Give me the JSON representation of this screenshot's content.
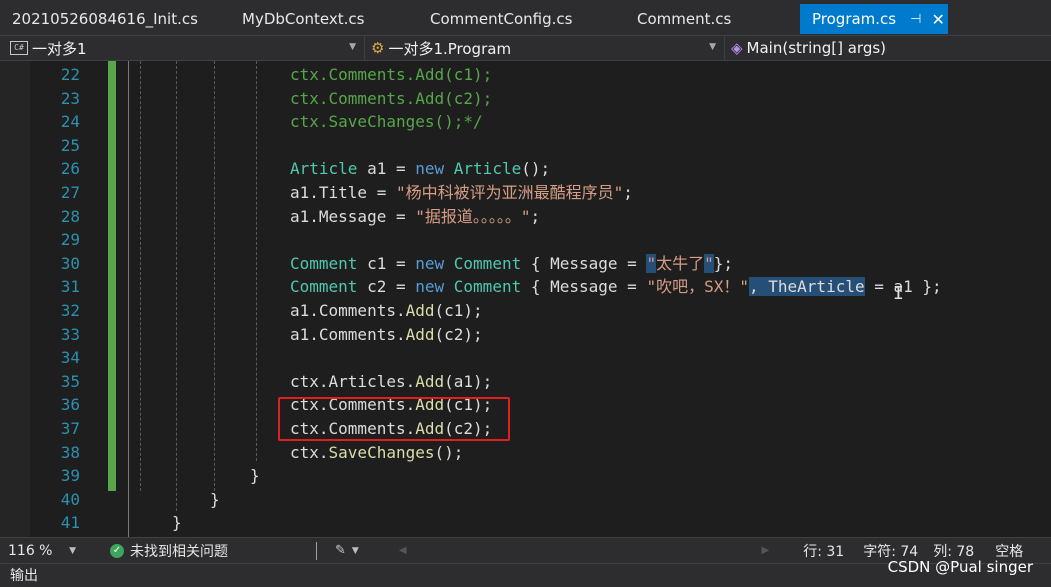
{
  "tabs": [
    {
      "label": "20210526084616_Init.cs"
    },
    {
      "label": "MyDbContext.cs"
    },
    {
      "label": "CommentConfig.cs"
    },
    {
      "label": "Comment.cs"
    },
    {
      "label": "Program.cs",
      "active": true,
      "pin": "⊣",
      "close": "✕"
    }
  ],
  "nav": {
    "project": "一对多1",
    "class": "一对多1.Program",
    "member": "Main(string[] args)"
  },
  "editor": {
    "line_numbers": [
      "22",
      "23",
      "24",
      "25",
      "26",
      "27",
      "28",
      "29",
      "30",
      "31",
      "32",
      "33",
      "34",
      "35",
      "36",
      "37",
      "38",
      "39",
      "40",
      "41"
    ],
    "lines": [
      {
        "n": "22",
        "tokens": [
          {
            "t": "ctx.Comments.Add(c1);",
            "c": "comment"
          }
        ]
      },
      {
        "n": "23",
        "tokens": [
          {
            "t": "ctx.Comments.Add(c2);",
            "c": "comment"
          }
        ]
      },
      {
        "n": "24",
        "tokens": [
          {
            "t": "ctx.SaveChanges();*/",
            "c": "comment"
          }
        ]
      },
      {
        "n": "25",
        "tokens": []
      },
      {
        "n": "26",
        "tokens": [
          {
            "t": "Article",
            "c": "type"
          },
          {
            "t": " a1 = ",
            "c": "id"
          },
          {
            "t": "new",
            "c": "kw"
          },
          {
            "t": " ",
            "c": "id"
          },
          {
            "t": "Article",
            "c": "type"
          },
          {
            "t": "();",
            "c": "id"
          }
        ]
      },
      {
        "n": "27",
        "tokens": [
          {
            "t": "a1.Title = ",
            "c": "id"
          },
          {
            "t": "\"杨中科被评为亚洲最酷程序员\"",
            "c": "str"
          },
          {
            "t": ";",
            "c": "id"
          }
        ]
      },
      {
        "n": "28",
        "tokens": [
          {
            "t": "a1.Message = ",
            "c": "id"
          },
          {
            "t": "\"据报道。。。。。\"",
            "c": "str"
          },
          {
            "t": ";",
            "c": "id"
          }
        ]
      },
      {
        "n": "29",
        "tokens": []
      },
      {
        "n": "30",
        "tokens": [
          {
            "t": "Comment",
            "c": "type"
          },
          {
            "t": " c1 = ",
            "c": "id"
          },
          {
            "t": "new",
            "c": "kw"
          },
          {
            "t": " ",
            "c": "id"
          },
          {
            "t": "Comment",
            "c": "type"
          },
          {
            "t": " { Message = ",
            "c": "id"
          },
          {
            "t": "\"",
            "c": "str hl"
          },
          {
            "t": "太牛了",
            "c": "str"
          },
          {
            "t": "\"",
            "c": "str hl"
          },
          {
            "t": "};",
            "c": "id"
          }
        ]
      },
      {
        "n": "31",
        "tokens": [
          {
            "t": "Comment",
            "c": "type"
          },
          {
            "t": " c2 = ",
            "c": "id"
          },
          {
            "t": "new",
            "c": "kw"
          },
          {
            "t": " ",
            "c": "id"
          },
          {
            "t": "Comment",
            "c": "type"
          },
          {
            "t": " { Message = ",
            "c": "id"
          },
          {
            "t": "\"吹吧，SX！\"",
            "c": "str"
          },
          {
            "t": ", TheArticle",
            "c": "id hl"
          },
          {
            "t": " = a1 };",
            "c": "id"
          }
        ]
      },
      {
        "n": "32",
        "tokens": [
          {
            "t": "a1.Comments.",
            "c": "id"
          },
          {
            "t": "Add",
            "c": "method"
          },
          {
            "t": "(c1);",
            "c": "id"
          }
        ]
      },
      {
        "n": "33",
        "tokens": [
          {
            "t": "a1.Comments.",
            "c": "id"
          },
          {
            "t": "Add",
            "c": "method"
          },
          {
            "t": "(c2);",
            "c": "id"
          }
        ]
      },
      {
        "n": "34",
        "tokens": []
      },
      {
        "n": "35",
        "tokens": [
          {
            "t": "ctx.Articles.",
            "c": "id"
          },
          {
            "t": "Add",
            "c": "method"
          },
          {
            "t": "(a1);",
            "c": "id"
          }
        ]
      },
      {
        "n": "36",
        "tokens": [
          {
            "t": "ctx.Comments.",
            "c": "id"
          },
          {
            "t": "Add",
            "c": "method"
          },
          {
            "t": "(c1);",
            "c": "id"
          }
        ]
      },
      {
        "n": "37",
        "tokens": [
          {
            "t": "ctx.Comments.",
            "c": "id"
          },
          {
            "t": "Add",
            "c": "method"
          },
          {
            "t": "(c2);",
            "c": "id"
          }
        ]
      },
      {
        "n": "38",
        "tokens": [
          {
            "t": "ctx.",
            "c": "id"
          },
          {
            "t": "SaveChanges",
            "c": "method"
          },
          {
            "t": "();",
            "c": "id"
          }
        ]
      },
      {
        "n": "39",
        "tokens": []
      },
      {
        "n": "40",
        "tokens": []
      },
      {
        "n": "41",
        "tokens": []
      }
    ],
    "braces": [
      {
        "line": "39",
        "text": "}"
      },
      {
        "line": "40",
        "text": "}"
      },
      {
        "line": "41",
        "text": "}"
      }
    ]
  },
  "status": {
    "zoom": "116 %",
    "issues": "未找到相关问题",
    "line": "行: 31",
    "char": "字符: 74",
    "col": "列: 78",
    "whitespace": "空格"
  },
  "output_panel": {
    "label": "输出"
  },
  "watermark": "CSDN @Pual singer",
  "colors": {
    "accent": "#007acc",
    "comment": "#57a64a",
    "type": "#4ec9b0",
    "keyword": "#569cd6",
    "string": "#d69d85",
    "line_number": "#2b91af",
    "annotation": "#e02020"
  }
}
